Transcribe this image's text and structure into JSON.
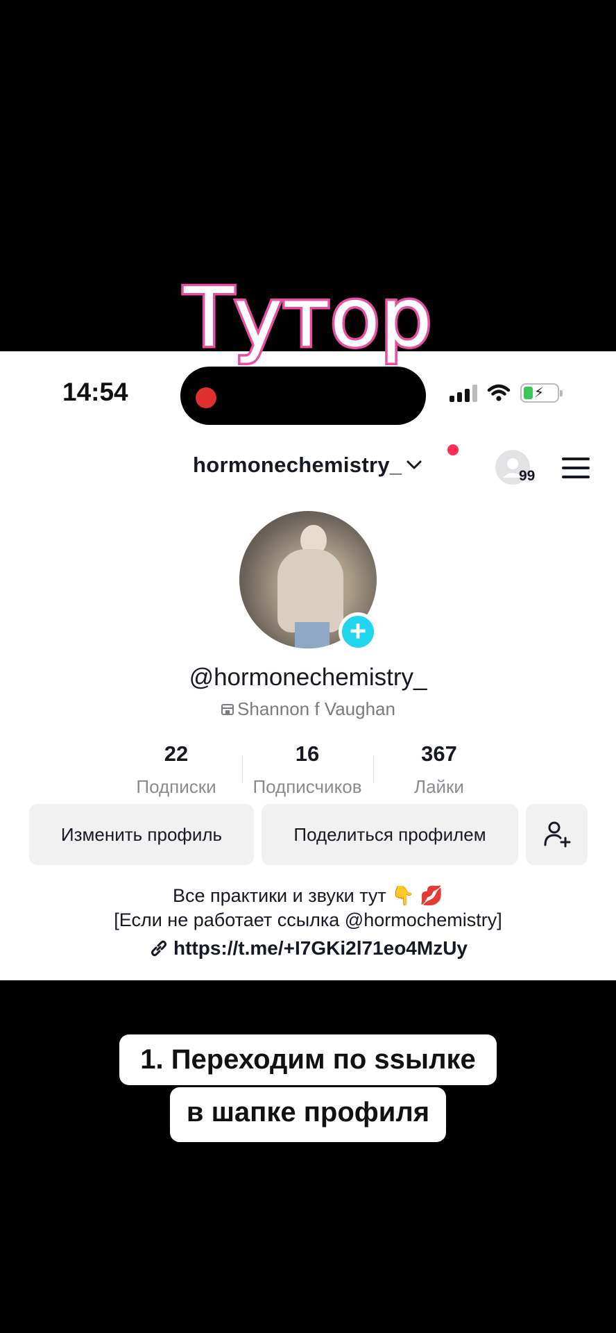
{
  "overlay_title": "Тутор",
  "status_bar": {
    "time": "14:54"
  },
  "profile_header": {
    "username": "hormonechemistry_",
    "visitors_count": "99"
  },
  "profile": {
    "handle": "@hormonechemistry_",
    "display_name": "Shannon f Vaughan",
    "stats": [
      {
        "value": "22",
        "label": "Подписки"
      },
      {
        "value": "16",
        "label": "Подписчиков"
      },
      {
        "value": "367",
        "label": "Лайки"
      }
    ],
    "buttons": {
      "edit": "Изменить профиль",
      "share": "Поделиться профилем"
    },
    "bio_line1": "Все практики и звуки тут 👇 💋",
    "bio_line2": "[Если не работает ссылка @hormochemistry]",
    "link": "https://t.me/+I7GKi2l71eo4MzUy"
  },
  "caption": {
    "line1": "1. Переходим по ssылке",
    "line2": "в шапке профиля"
  },
  "colors": {
    "accent_pink": "#e84fa3",
    "add_badge": "#20d5ec",
    "notification": "#fe2c55"
  }
}
